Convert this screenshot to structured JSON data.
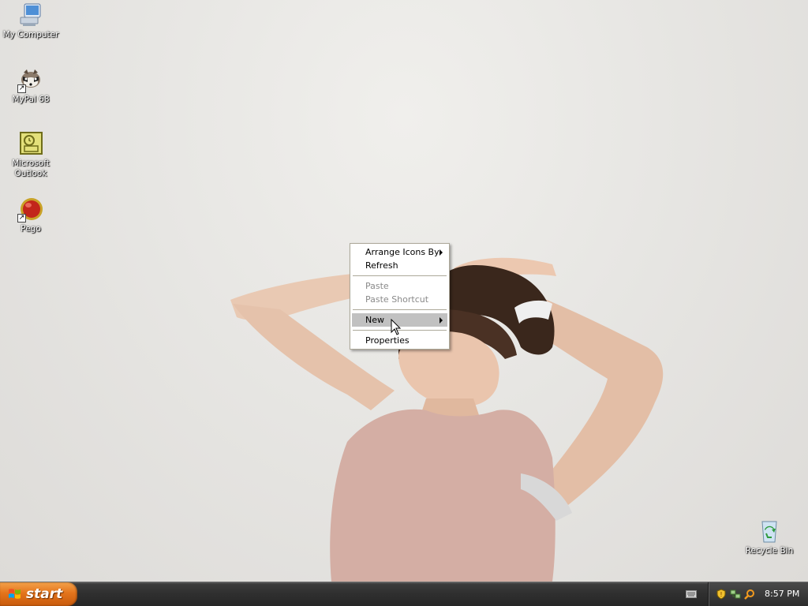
{
  "desktop": {
    "icons": [
      {
        "label": "My Computer",
        "icon": "my-computer-icon"
      },
      {
        "label": "MyPal 68",
        "icon": "mypal-icon",
        "shortcut": true
      },
      {
        "label": "Microsoft Outlook",
        "icon": "outlook-icon"
      },
      {
        "label": "Pego",
        "icon": "pego-icon",
        "shortcut": true
      },
      {
        "label": "Recycle Bin",
        "icon": "recycle-bin-icon"
      }
    ]
  },
  "context_menu": {
    "items": [
      {
        "label": "Arrange Icons By",
        "submenu": true,
        "enabled": true
      },
      {
        "label": "Refresh",
        "submenu": false,
        "enabled": true
      },
      {
        "label": "Paste",
        "submenu": false,
        "enabled": false
      },
      {
        "label": "Paste Shortcut",
        "submenu": false,
        "enabled": false
      },
      {
        "label": "New",
        "submenu": true,
        "enabled": true,
        "highlighted": true
      },
      {
        "label": "Properties",
        "submenu": false,
        "enabled": true
      }
    ]
  },
  "taskbar": {
    "start_label": "start",
    "clock": "8:57 PM",
    "tray_icons": [
      "keyboard-icon",
      "security-shield-icon",
      "network-icon",
      "search-icon"
    ]
  },
  "colors": {
    "start_button": "#e3741c",
    "taskbar": "#2f2f2f",
    "menu_highlight": "#c1c1c1"
  }
}
